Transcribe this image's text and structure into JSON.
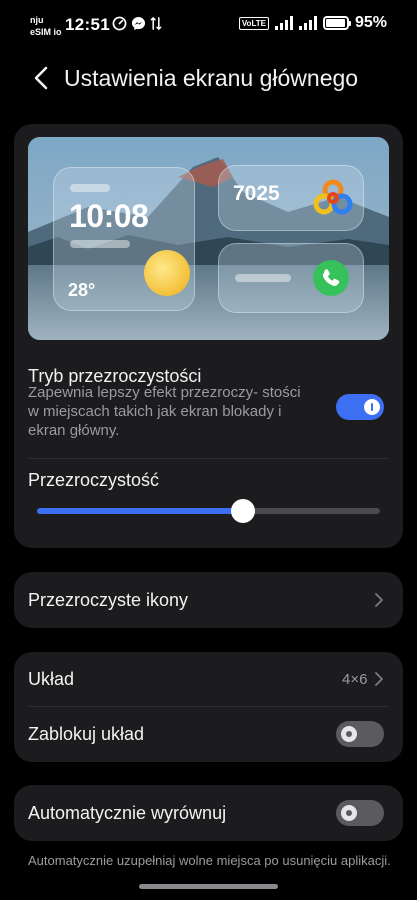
{
  "status_bar": {
    "carrier_line1": "nju",
    "carrier_line2": "eSIM io",
    "time": "12:51",
    "volte": "VoLTE",
    "battery": "95%",
    "battery_level": 0.95
  },
  "header": {
    "back_icon": "chevron-left-icon",
    "title": "Ustawienia ekranu głównego"
  },
  "preview": {
    "clock": "10:08",
    "temperature": "28°",
    "steps": "7025"
  },
  "transparency_card": {
    "mode_title": "Tryb przezroczystości",
    "mode_description": "Zapewnia lepszy efekt przezroczy- stości w miejscach takich jak ekran blokady i ekran główny.",
    "mode_enabled": true,
    "slider_title": "Przezroczystość",
    "slider_value": 0.6
  },
  "icons_card": {
    "label": "Przezroczyste ikony"
  },
  "layout_card": {
    "layout_label": "Układ",
    "layout_value": "4×6",
    "lock_label": "Zablokuj układ",
    "lock_enabled": false
  },
  "auto_align_card": {
    "label": "Automatycznie wyrównuj",
    "enabled": false,
    "footnote": "Automatycznie uzupełniaj wolne miejsca po usunięciu aplikacji."
  },
  "colors": {
    "accent": "#3d6ff2",
    "card_bg": "#1c1c1e",
    "secondary_text": "#9b9ba0"
  }
}
